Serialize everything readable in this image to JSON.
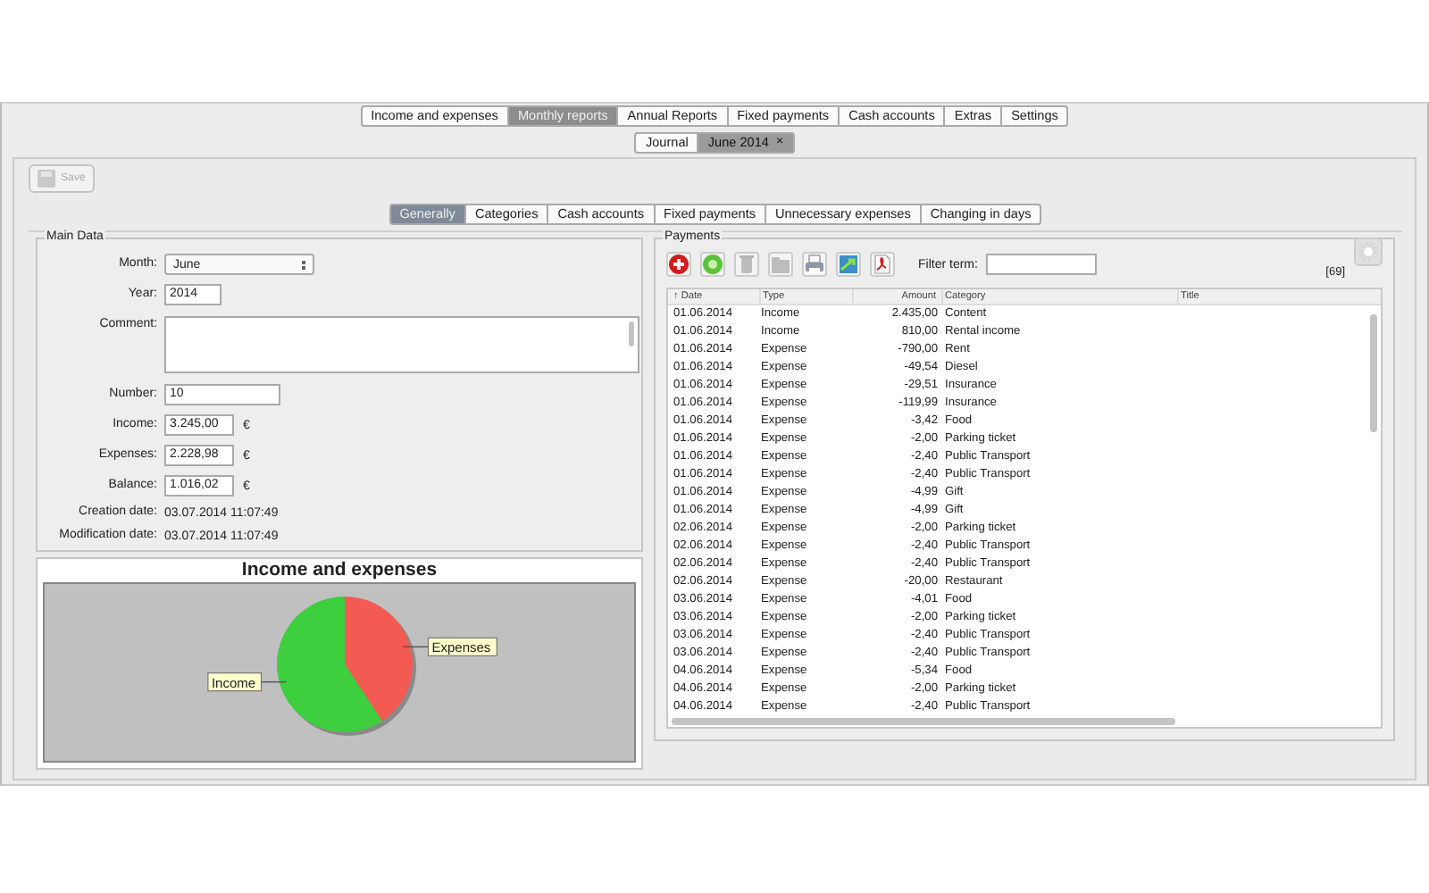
{
  "main_tabs": [
    {
      "label": "Income and expenses",
      "selected": false
    },
    {
      "label": "Monthly reports",
      "selected": true
    },
    {
      "label": "Annual Reports",
      "selected": false
    },
    {
      "label": "Fixed payments",
      "selected": false
    },
    {
      "label": "Cash accounts",
      "selected": false
    },
    {
      "label": "Extras",
      "selected": false
    },
    {
      "label": "Settings",
      "selected": false
    }
  ],
  "document_tabs": [
    {
      "label": "Journal",
      "selected": false
    },
    {
      "label": "June 2014",
      "selected": true,
      "close": "×"
    }
  ],
  "save_button": {
    "label": "Save",
    "disabled": true
  },
  "section_tabs": [
    {
      "label": "Generally",
      "selected": true
    },
    {
      "label": "Categories",
      "selected": false
    },
    {
      "label": "Cash accounts",
      "selected": false
    },
    {
      "label": "Fixed payments",
      "selected": false
    },
    {
      "label": "Unnecessary expenses",
      "selected": false
    },
    {
      "label": "Changing in days",
      "selected": false
    }
  ],
  "main_data": {
    "title": "Main Data",
    "fields": [
      {
        "kind": "select",
        "label": "Month:",
        "value": "June"
      },
      {
        "kind": "text",
        "label": "Year:",
        "value": "2014"
      },
      {
        "kind": "textarea",
        "label": "Comment:"
      },
      {
        "kind": "wide",
        "label": "Number:",
        "value": "10"
      },
      {
        "kind": "amount",
        "label": "Income:",
        "value": "3.245,00",
        "unit": "€"
      },
      {
        "kind": "amount",
        "label": "Expenses:",
        "value": "2.228,98",
        "unit": "€"
      },
      {
        "kind": "amount",
        "label": "Balance:",
        "value": "1.016,02",
        "unit": "€"
      },
      {
        "kind": "info",
        "label": "Creation date:",
        "value": "03.07.2014 11:07:49"
      },
      {
        "kind": "info",
        "label": "Modification date:",
        "value": "03.07.2014 11:07:49"
      }
    ]
  },
  "chart": {
    "chart_data": {
      "type": "pie",
      "title": "Income and expenses",
      "categories": [
        "Income",
        "Expenses"
      ],
      "series": [
        {
          "values": [
            59.28,
            40.72
          ]
        }
      ]
    }
  },
  "payments": {
    "title": "Payments",
    "tools": [
      {
        "kind": "add",
        "disabled": false
      },
      {
        "kind": "add-green",
        "disabled": false
      },
      {
        "kind": "delete",
        "disabled": true
      },
      {
        "kind": "archive",
        "disabled": true
      },
      {
        "kind": "print",
        "disabled": false
      },
      {
        "kind": "export",
        "disabled": false
      },
      {
        "kind": "pdf",
        "disabled": false
      }
    ],
    "filter_label": "Filter term:",
    "count": "[69]",
    "settings_disabled": true,
    "columns": [
      "↑ Date",
      "Type",
      "Amount",
      "Category",
      "Title"
    ],
    "rows": [
      [
        "01.06.2014",
        "Income",
        "2.435,00",
        "Content"
      ],
      [
        "01.06.2014",
        "Income",
        "810,00",
        "Rental income"
      ],
      [
        "01.06.2014",
        "Expense",
        "-790,00",
        "Rent"
      ],
      [
        "01.06.2014",
        "Expense",
        "-49,54",
        "Diesel"
      ],
      [
        "01.06.2014",
        "Expense",
        "-29,51",
        "Insurance"
      ],
      [
        "01.06.2014",
        "Expense",
        "-119,99",
        "Insurance"
      ],
      [
        "01.06.2014",
        "Expense",
        "-3,42",
        "Food"
      ],
      [
        "01.06.2014",
        "Expense",
        "-2,00",
        "Parking ticket"
      ],
      [
        "01.06.2014",
        "Expense",
        "-2,40",
        "Public Transport"
      ],
      [
        "01.06.2014",
        "Expense",
        "-2,40",
        "Public Transport"
      ],
      [
        "01.06.2014",
        "Expense",
        "-4,99",
        "Gift"
      ],
      [
        "01.06.2014",
        "Expense",
        "-4,99",
        "Gift"
      ],
      [
        "02.06.2014",
        "Expense",
        "-2,00",
        "Parking ticket"
      ],
      [
        "02.06.2014",
        "Expense",
        "-2,40",
        "Public Transport"
      ],
      [
        "02.06.2014",
        "Expense",
        "-2,40",
        "Public Transport"
      ],
      [
        "02.06.2014",
        "Expense",
        "-20,00",
        "Restaurant"
      ],
      [
        "03.06.2014",
        "Expense",
        "-4,01",
        "Food"
      ],
      [
        "03.06.2014",
        "Expense",
        "-2,00",
        "Parking ticket"
      ],
      [
        "03.06.2014",
        "Expense",
        "-2,40",
        "Public Transport"
      ],
      [
        "03.06.2014",
        "Expense",
        "-2,40",
        "Public Transport"
      ],
      [
        "04.06.2014",
        "Expense",
        "-5,34",
        "Food"
      ],
      [
        "04.06.2014",
        "Expense",
        "-2,00",
        "Parking ticket"
      ],
      [
        "04.06.2014",
        "Expense",
        "-2,40",
        "Public Transport"
      ]
    ]
  }
}
